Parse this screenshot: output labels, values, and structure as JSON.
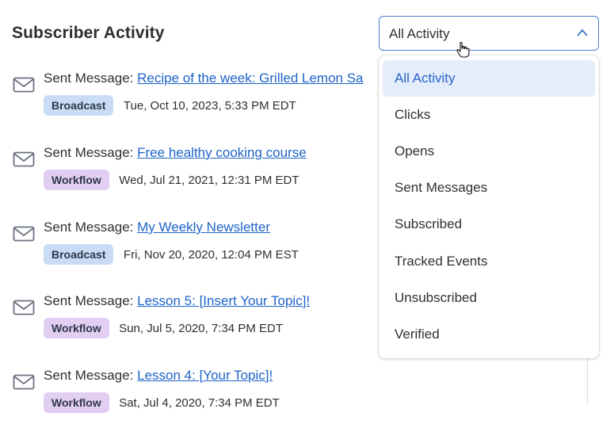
{
  "header": {
    "title": "Subscriber Activity"
  },
  "filter": {
    "selected": "All Activity",
    "options": [
      "All Activity",
      "Clicks",
      "Opens",
      "Sent Messages",
      "Subscribed",
      "Tracked Events",
      "Unsubscribed",
      "Verified"
    ]
  },
  "activities": [
    {
      "prefix": "Sent Message:",
      "link": "Recipe of the week: Grilled Lemon Sa",
      "badge": "Broadcast",
      "timestamp": "Tue, Oct 10, 2023, 5:33 PM EDT"
    },
    {
      "prefix": "Sent Message:",
      "link": "Free healthy cooking course",
      "badge": "Workflow",
      "timestamp": "Wed, Jul 21, 2021, 12:31 PM EDT"
    },
    {
      "prefix": "Sent Message:",
      "link": "My Weekly Newsletter",
      "badge": "Broadcast",
      "timestamp": "Fri, Nov 20, 2020, 12:04 PM EST"
    },
    {
      "prefix": "Sent Message:",
      "link": "Lesson 5: [Insert Your Topic]!",
      "badge": "Workflow",
      "timestamp": "Sun, Jul 5, 2020, 7:34 PM EDT"
    },
    {
      "prefix": "Sent Message:",
      "link": "Lesson 4: [Your Topic]!",
      "badge": "Workflow",
      "timestamp": "Sat, Jul 4, 2020, 7:34 PM EDT"
    }
  ],
  "colors": {
    "link": "#1e63c8",
    "broadcast_badge": "#c9dcf5",
    "workflow_badge": "#e2cdf3",
    "selected_option_bg": "#e4edfb",
    "select_border": "#4a7fd1"
  },
  "icons": {
    "activity": "mail-icon",
    "dropdown": "chevron-up-icon",
    "pointer": "hand-cursor-icon"
  }
}
